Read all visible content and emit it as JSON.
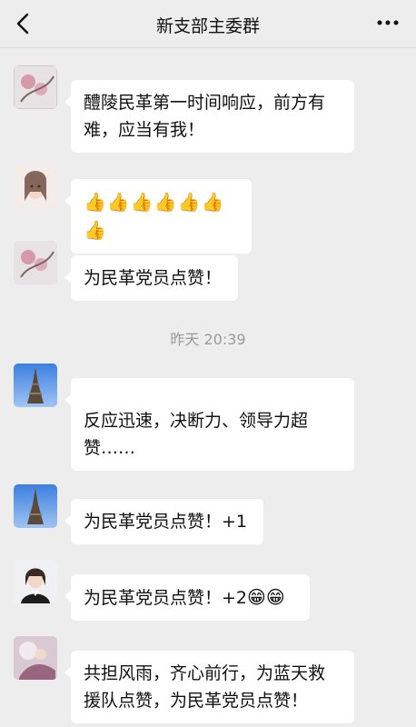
{
  "header": {
    "title": "新支部主委群"
  },
  "messages": [
    {
      "text": "醴陵民革第一时间响应，前方有难，应当有我！"
    },
    {
      "emoji": "👍",
      "count_label": "👍👍👍👍👍👍👍"
    },
    {
      "text": "为民革党员点赞！"
    },
    {
      "timestamp": "昨天 20:39"
    },
    {
      "text": "反应迅速，决断力、领导力超赞……"
    },
    {
      "text": "为民革党员点赞！+1"
    },
    {
      "text": "为民革党员点赞！+2",
      "emoji": "😁😁"
    },
    {
      "text": "共担风雨，齐心前行，为蓝天救援队点赞，为民革党员点赞！"
    }
  ],
  "colors": {
    "background": "#ededed",
    "bubble": "#ffffff",
    "timestamp": "#9a9a9a"
  },
  "icons": [
    "back-icon",
    "more-icon"
  ]
}
